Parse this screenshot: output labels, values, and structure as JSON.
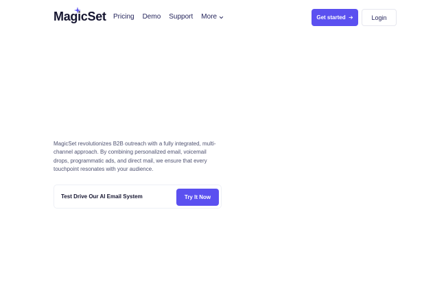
{
  "brand": {
    "name": "MagicSet",
    "accent_color": "#5b50f0",
    "spark_icon": "sparkle-icon"
  },
  "nav": {
    "links": [
      {
        "label": "Pricing"
      },
      {
        "label": "Demo"
      },
      {
        "label": "Support"
      },
      {
        "label": "More",
        "icon": "chevron-down-icon"
      }
    ],
    "get_started_label": "Get started",
    "get_started_icon": "arrow-right-icon",
    "login_label": "Login"
  },
  "hero": {
    "description": "MagicSet revolutionizes B2B outreach with a fully integrated, multi-channel approach.  By combining personalized email, voicemail drops, programmatic ads, and direct mail, we ensure that every touchpoint resonates with your audience."
  },
  "cta": {
    "label": "Test Drive Our AI Email System",
    "button_label": "Try It Now"
  }
}
